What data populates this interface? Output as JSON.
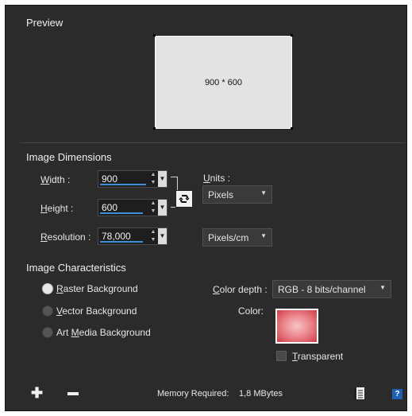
{
  "preview": {
    "title": "Preview",
    "dimensions_text": "900 * 600"
  },
  "image_dimensions": {
    "title": "Image Dimensions",
    "width_label": "Width :",
    "width_value": "900",
    "height_label": "Height :",
    "height_value": "600",
    "resolution_label": "Resolution :",
    "resolution_value": "78,000",
    "units_label": "Units :",
    "units_value": "Pixels",
    "resolution_units_value": "Pixels/cm"
  },
  "image_characteristics": {
    "title": "Image Characteristics",
    "options": [
      {
        "label": "Raster Background",
        "selected": true
      },
      {
        "label": "Vector Background",
        "selected": false
      },
      {
        "label": "Art Media Background",
        "selected": false
      }
    ],
    "color_depth_label": "Color depth :",
    "color_depth_value": "RGB - 8 bits/channel",
    "color_label": "Color:",
    "color_value": "#e05a63",
    "transparent_label": "Transparent",
    "transparent_checked": false
  },
  "footer": {
    "add_icon": "plus-icon",
    "remove_icon": "minus-icon",
    "memory_label": "Memory Required:",
    "memory_value": "1,8 MBytes",
    "info_icon": "document-info-icon",
    "help_icon": "help-icon",
    "help_glyph": "?"
  },
  "colors": {
    "background": "#2b2b2b",
    "accent_underline": "#3d8fd6"
  }
}
